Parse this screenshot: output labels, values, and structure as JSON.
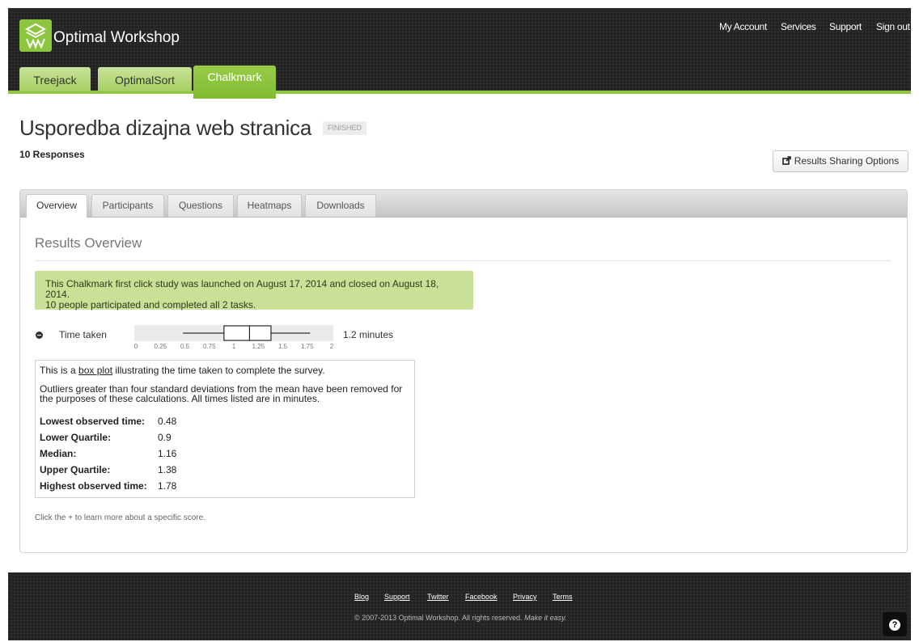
{
  "brand": {
    "name": "Optimal Workshop",
    "accent_color": "#8cc63f",
    "logo_icon": "optimal-workshop-logo-icon"
  },
  "top_nav": [
    "My Account",
    "Services",
    "Support",
    "Sign out"
  ],
  "product_tabs": [
    {
      "label": "Treejack",
      "active": false
    },
    {
      "label": "OptimalSort",
      "active": false
    },
    {
      "label": "Chalkmark",
      "active": true
    }
  ],
  "study": {
    "title": "Usporedba dizajna web stranica",
    "status": "FINISHED",
    "responses": "10 Responses"
  },
  "share_button": {
    "icon": "share-external-icon",
    "label": "Results Sharing Options"
  },
  "tabs": [
    {
      "label": "Overview",
      "active": true
    },
    {
      "label": "Participants",
      "active": false
    },
    {
      "label": "Questions",
      "active": false
    },
    {
      "label": "Heatmaps",
      "active": false
    },
    {
      "label": "Downloads",
      "active": false
    }
  ],
  "section_title": "Results Overview",
  "info_box": {
    "line1": "This Chalkmark first click study was launched on August 17, 2014 and closed on August 18, 2014.",
    "line2": "10 people participated and completed all 2 tasks.",
    "color": "#c9e196"
  },
  "metric": {
    "icon": "minus-circle-icon",
    "label": "Time taken",
    "value": "1.2 minutes"
  },
  "chart_data": {
    "type": "boxplot",
    "xlim": [
      0,
      2
    ],
    "ticks": [
      "0",
      "0.25",
      "0.5",
      "0.75",
      "1",
      "1.25",
      "1.5",
      "1.75",
      "2"
    ],
    "min": 0.48,
    "q1": 0.9,
    "median": 1.16,
    "q3": 1.38,
    "max": 1.78
  },
  "stats": {
    "intro_pre": "This is a ",
    "intro_link": "box plot",
    "intro_post": " illustrating the time taken to complete the survey.",
    "note": "Outliers greater than four standard deviations from the mean have been removed for the purposes of these calculations. All times listed are in minutes.",
    "rows": [
      {
        "label": "Lowest observed time:",
        "value": "0.48"
      },
      {
        "label": "Lower Quartile:",
        "value": "0.9"
      },
      {
        "label": "Median:",
        "value": "1.16"
      },
      {
        "label": "Upper Quartile:",
        "value": "1.38"
      },
      {
        "label": "Highest observed time:",
        "value": "1.78"
      }
    ]
  },
  "help_line": "Click the + to learn more about a specific score.",
  "footer": {
    "links": [
      "Blog",
      "Support",
      "Twitter",
      "Facebook",
      "Privacy",
      "Terms"
    ],
    "copyright": "© 2007-2013 Optimal Workshop. All rights reserved.",
    "tagline": "Make it easy.",
    "help_icon": "question-mark-icon"
  }
}
